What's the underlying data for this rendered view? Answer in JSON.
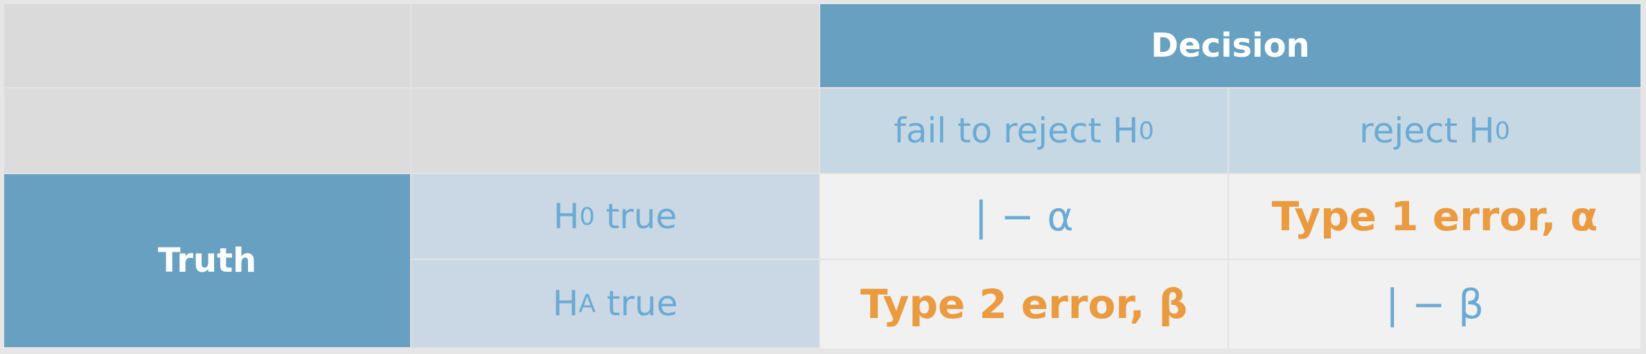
{
  "header": {
    "decision_label": "Decision",
    "decision_options": [
      {
        "text": "fail to reject H",
        "sub": "0"
      },
      {
        "text": "reject H",
        "sub": "0"
      }
    ]
  },
  "rows_header": {
    "truth_label": "Truth",
    "hypotheses": [
      {
        "prefix": "H",
        "sub": "0",
        "suffix": " true"
      },
      {
        "prefix": "H",
        "sub": "A",
        "suffix": " true"
      }
    ]
  },
  "cells": [
    [
      "| − α",
      "Type 1 error, α"
    ],
    [
      "Type 2 error, β",
      "| − β"
    ]
  ],
  "colors": {
    "header_fill": "#67a0c0",
    "subheader_fill": "#c7d8e5",
    "label_blue": "#6aaad3",
    "error_orange": "#ea9b3f"
  }
}
